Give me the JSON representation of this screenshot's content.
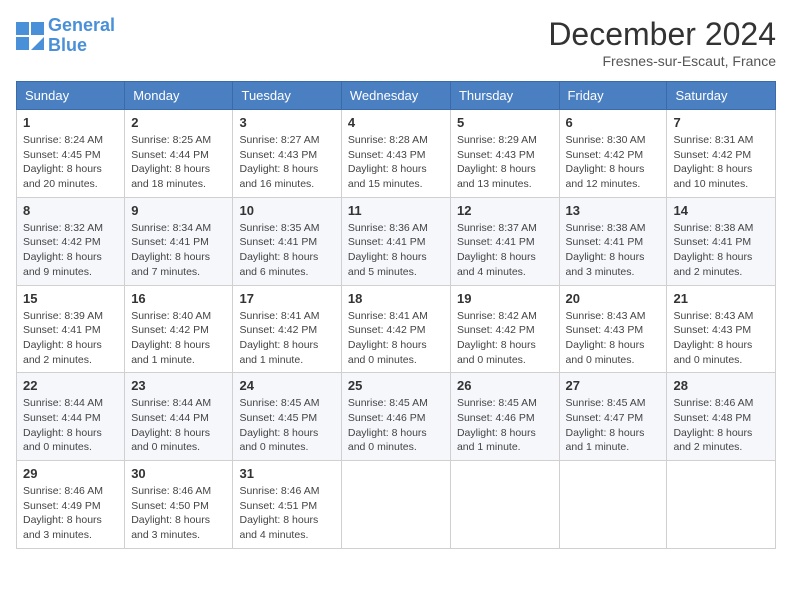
{
  "logo": {
    "line1": "General",
    "line2": "Blue"
  },
  "title": "December 2024",
  "location": "Fresnes-sur-Escaut, France",
  "days_of_week": [
    "Sunday",
    "Monday",
    "Tuesday",
    "Wednesday",
    "Thursday",
    "Friday",
    "Saturday"
  ],
  "weeks": [
    [
      {
        "day": "1",
        "info": "Sunrise: 8:24 AM\nSunset: 4:45 PM\nDaylight: 8 hours\nand 20 minutes."
      },
      {
        "day": "2",
        "info": "Sunrise: 8:25 AM\nSunset: 4:44 PM\nDaylight: 8 hours\nand 18 minutes."
      },
      {
        "day": "3",
        "info": "Sunrise: 8:27 AM\nSunset: 4:43 PM\nDaylight: 8 hours\nand 16 minutes."
      },
      {
        "day": "4",
        "info": "Sunrise: 8:28 AM\nSunset: 4:43 PM\nDaylight: 8 hours\nand 15 minutes."
      },
      {
        "day": "5",
        "info": "Sunrise: 8:29 AM\nSunset: 4:43 PM\nDaylight: 8 hours\nand 13 minutes."
      },
      {
        "day": "6",
        "info": "Sunrise: 8:30 AM\nSunset: 4:42 PM\nDaylight: 8 hours\nand 12 minutes."
      },
      {
        "day": "7",
        "info": "Sunrise: 8:31 AM\nSunset: 4:42 PM\nDaylight: 8 hours\nand 10 minutes."
      }
    ],
    [
      {
        "day": "8",
        "info": "Sunrise: 8:32 AM\nSunset: 4:42 PM\nDaylight: 8 hours\nand 9 minutes."
      },
      {
        "day": "9",
        "info": "Sunrise: 8:34 AM\nSunset: 4:41 PM\nDaylight: 8 hours\nand 7 minutes."
      },
      {
        "day": "10",
        "info": "Sunrise: 8:35 AM\nSunset: 4:41 PM\nDaylight: 8 hours\nand 6 minutes."
      },
      {
        "day": "11",
        "info": "Sunrise: 8:36 AM\nSunset: 4:41 PM\nDaylight: 8 hours\nand 5 minutes."
      },
      {
        "day": "12",
        "info": "Sunrise: 8:37 AM\nSunset: 4:41 PM\nDaylight: 8 hours\nand 4 minutes."
      },
      {
        "day": "13",
        "info": "Sunrise: 8:38 AM\nSunset: 4:41 PM\nDaylight: 8 hours\nand 3 minutes."
      },
      {
        "day": "14",
        "info": "Sunrise: 8:38 AM\nSunset: 4:41 PM\nDaylight: 8 hours\nand 2 minutes."
      }
    ],
    [
      {
        "day": "15",
        "info": "Sunrise: 8:39 AM\nSunset: 4:41 PM\nDaylight: 8 hours\nand 2 minutes."
      },
      {
        "day": "16",
        "info": "Sunrise: 8:40 AM\nSunset: 4:42 PM\nDaylight: 8 hours\nand 1 minute."
      },
      {
        "day": "17",
        "info": "Sunrise: 8:41 AM\nSunset: 4:42 PM\nDaylight: 8 hours\nand 1 minute."
      },
      {
        "day": "18",
        "info": "Sunrise: 8:41 AM\nSunset: 4:42 PM\nDaylight: 8 hours\nand 0 minutes."
      },
      {
        "day": "19",
        "info": "Sunrise: 8:42 AM\nSunset: 4:42 PM\nDaylight: 8 hours\nand 0 minutes."
      },
      {
        "day": "20",
        "info": "Sunrise: 8:43 AM\nSunset: 4:43 PM\nDaylight: 8 hours\nand 0 minutes."
      },
      {
        "day": "21",
        "info": "Sunrise: 8:43 AM\nSunset: 4:43 PM\nDaylight: 8 hours\nand 0 minutes."
      }
    ],
    [
      {
        "day": "22",
        "info": "Sunrise: 8:44 AM\nSunset: 4:44 PM\nDaylight: 8 hours\nand 0 minutes."
      },
      {
        "day": "23",
        "info": "Sunrise: 8:44 AM\nSunset: 4:44 PM\nDaylight: 8 hours\nand 0 minutes."
      },
      {
        "day": "24",
        "info": "Sunrise: 8:45 AM\nSunset: 4:45 PM\nDaylight: 8 hours\nand 0 minutes."
      },
      {
        "day": "25",
        "info": "Sunrise: 8:45 AM\nSunset: 4:46 PM\nDaylight: 8 hours\nand 0 minutes."
      },
      {
        "day": "26",
        "info": "Sunrise: 8:45 AM\nSunset: 4:46 PM\nDaylight: 8 hours\nand 1 minute."
      },
      {
        "day": "27",
        "info": "Sunrise: 8:45 AM\nSunset: 4:47 PM\nDaylight: 8 hours\nand 1 minute."
      },
      {
        "day": "28",
        "info": "Sunrise: 8:46 AM\nSunset: 4:48 PM\nDaylight: 8 hours\nand 2 minutes."
      }
    ],
    [
      {
        "day": "29",
        "info": "Sunrise: 8:46 AM\nSunset: 4:49 PM\nDaylight: 8 hours\nand 3 minutes."
      },
      {
        "day": "30",
        "info": "Sunrise: 8:46 AM\nSunset: 4:50 PM\nDaylight: 8 hours\nand 3 minutes."
      },
      {
        "day": "31",
        "info": "Sunrise: 8:46 AM\nSunset: 4:51 PM\nDaylight: 8 hours\nand 4 minutes."
      },
      null,
      null,
      null,
      null
    ]
  ]
}
